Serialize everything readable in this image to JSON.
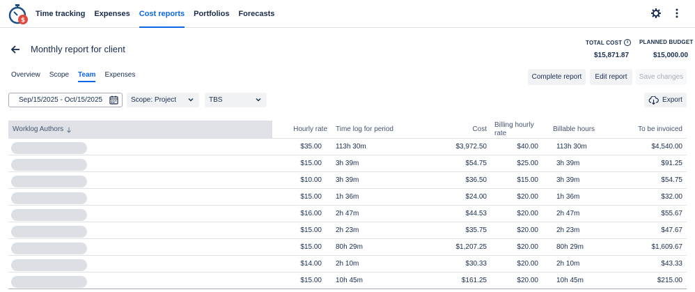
{
  "nav": {
    "items": [
      "Time tracking",
      "Expenses",
      "Cost reports",
      "Portfolios",
      "Forecasts"
    ],
    "active_index": 2
  },
  "header": {
    "title": "Monthly report for client",
    "total_cost_label": "TOTAL COST",
    "total_cost_value": "$15,871.87",
    "planned_budget_label": "PLANNED BUDGET",
    "planned_budget_value": "$15,000.00"
  },
  "subtabs": {
    "items": [
      "Overview",
      "Scope",
      "Team",
      "Expenses"
    ],
    "active_index": 2
  },
  "actions": {
    "complete": "Complete report",
    "edit": "Edit report",
    "save": "Save changes"
  },
  "filters": {
    "date_range": "Sep/15/2025 - Oct/15/2025",
    "scope": "Scope: Project",
    "tbs": "TBS",
    "export": "Export"
  },
  "table": {
    "columns": {
      "authors": "Worklog Authors",
      "rate": "Hourly rate",
      "log": "Time log for period",
      "cost": "Cost",
      "billing_rate_1": "Billing hourly",
      "billing_rate_2": "rate",
      "billable": "Billable hours",
      "invoiced": "To be invoiced"
    },
    "rows": [
      {
        "rate": "$35.00",
        "log": "113h 30m",
        "cost": "$3,972.50",
        "bill": "$40.00",
        "billable": "113h 30m",
        "invoice": "$4,540.00"
      },
      {
        "rate": "$15.00",
        "log": "3h 39m",
        "cost": "$54.75",
        "bill": "$25.00",
        "billable": "3h 39m",
        "invoice": "$91.25"
      },
      {
        "rate": "$10.00",
        "log": "3h 39m",
        "cost": "$36.50",
        "bill": "$15.00",
        "billable": "3h 39m",
        "invoice": "$54.75"
      },
      {
        "rate": "$15.00",
        "log": "1h 36m",
        "cost": "$24.00",
        "bill": "$20.00",
        "billable": "1h 36m",
        "invoice": "$32.00"
      },
      {
        "rate": "$16.00",
        "log": "2h 47m",
        "cost": "$44.53",
        "bill": "$20.00",
        "billable": "2h 47m",
        "invoice": "$55.67"
      },
      {
        "rate": "$15.00",
        "log": "2h 23m",
        "cost": "$35.75",
        "bill": "$20.00",
        "billable": "2h 23m",
        "invoice": "$47.67"
      },
      {
        "rate": "$15.00",
        "log": "80h 29m",
        "cost": "$1,207.25",
        "bill": "$20.00",
        "billable": "80h 29m",
        "invoice": "$1,609.67"
      },
      {
        "rate": "$14.00",
        "log": "2h 10m",
        "cost": "$30.33",
        "bill": "$20.00",
        "billable": "2h 10m",
        "invoice": "$43.33"
      },
      {
        "rate": "$15.00",
        "log": "10h 45m",
        "cost": "$161.25",
        "bill": "$20.00",
        "billable": "10h 45m",
        "invoice": "$215.00"
      }
    ]
  },
  "colors": {
    "accent": "#0c66e4",
    "text": "#172b4d",
    "logo_red": "#e2483d",
    "logo_blue": "#1d4e89"
  }
}
